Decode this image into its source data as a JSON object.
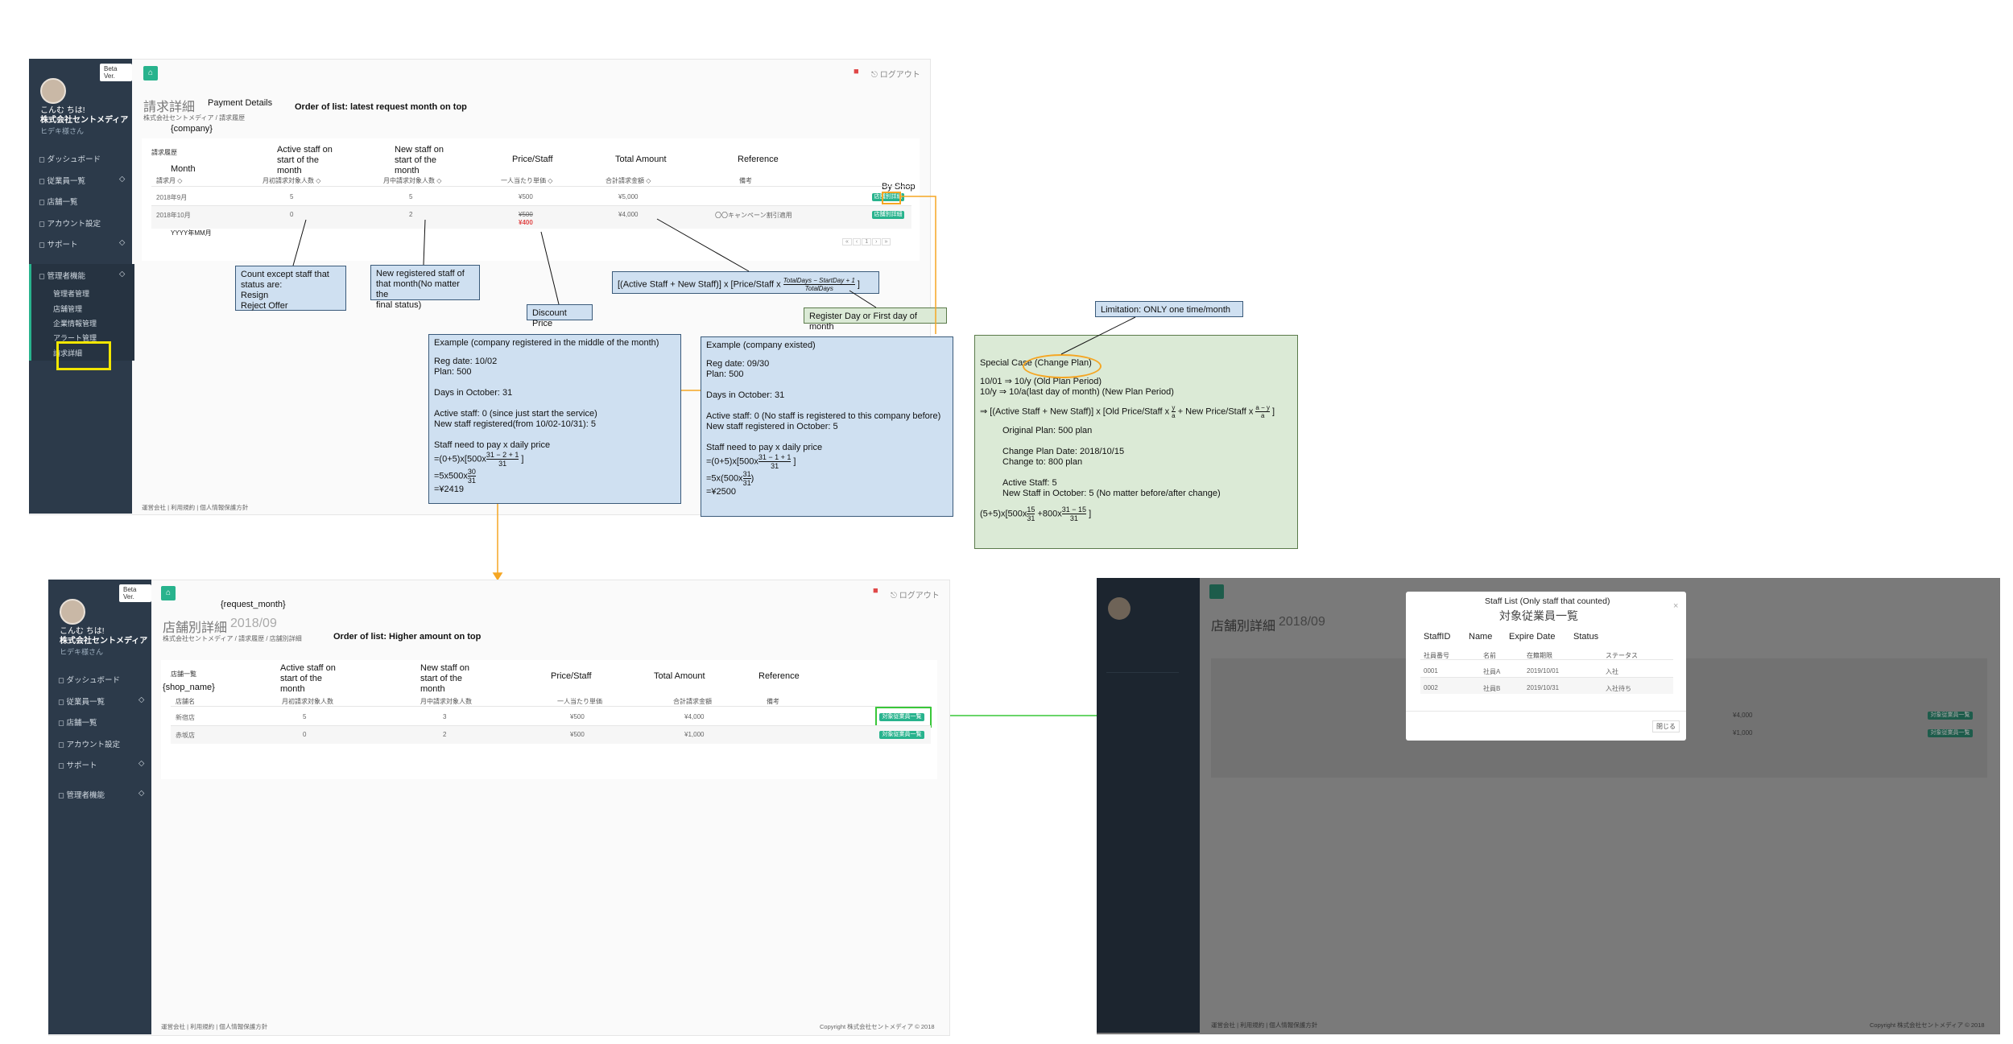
{
  "colors": {
    "sidebar": "#2c3a4a",
    "accent": "#28b38d",
    "annotation_blue": "#cfe0f1",
    "annotation_green": "#dbead6",
    "orange": "#f5a623",
    "highlight_yellow": "#f2e600",
    "arrow_green": "#39c739"
  },
  "screen1": {
    "beta": "Beta Ver.",
    "profile_name": "こんむ ちは!",
    "company": "株式会社セントメディア",
    "user": "ヒデキ様さん",
    "nav": [
      {
        "label": "ダッシュボード",
        "icon": "dashboard-icon"
      },
      {
        "label": "従業員一覧",
        "icon": "users-icon"
      },
      {
        "label": "店舗一覧",
        "icon": "store-icon"
      },
      {
        "label": "アカウント設定",
        "icon": "account-icon"
      },
      {
        "label": "サポート",
        "icon": "support-icon"
      },
      {
        "label": "管理者機能",
        "icon": "admin-icon"
      }
    ],
    "admin_sub": [
      "管理者管理",
      "店舗管理",
      "企業情報管理",
      "アラート管理",
      "請求詳細"
    ],
    "logout": "ログアウト",
    "title_jp": "請求詳細",
    "title_en": "Payment Details",
    "order_note": "Order of list: latest request month on top",
    "breadcrumb": "株式会社セントメディア  /  請求履歴",
    "company_var": "{company}",
    "card_title": "請求履歴",
    "col_en": [
      "Month",
      "Active staff on start of the month",
      "New staff on start of the month",
      "Price/Staff",
      "Total Amount",
      "Reference"
    ],
    "col_jp": [
      "請求月 ◇",
      "月初請求対象人数 ◇",
      "月中請求対象人数 ◇",
      "一人当たり単価 ◇",
      "合計請求金額 ◇",
      "備考"
    ],
    "by_shop": "By Shop",
    "rows": [
      {
        "month": "2018年9月",
        "active": "5",
        "new": "5",
        "price": "¥500",
        "total": "¥5,000",
        "ref": "",
        "btn": "店舗別詳細"
      },
      {
        "month": "2018年10月",
        "active": "0",
        "new": "2",
        "price_old": "¥500",
        "price": "¥400",
        "total": "¥4,000",
        "ref": "〇〇キャンペーン割引適用",
        "btn": "店舗別詳細"
      }
    ],
    "format_note": "YYYY年MM月",
    "pager": [
      "«",
      "‹",
      "1",
      "›",
      "»"
    ],
    "footer": "運営会社  |  利用規約  |  個人情報保護方針"
  },
  "annotations": {
    "count_except": "Count except staff that\nstatus are:\nResign\nReject Offer",
    "new_registered": "New registered staff of\nthat month(No matter the\nfinal status)",
    "discount": "Discount Price",
    "formula": "[(Active Staff + New Staff)] x [Price/Staff x ",
    "formula_frac_num": "TotalDays − StartDay + 1",
    "formula_frac_den": "TotalDays",
    "register_day": "Register Day or First day of month",
    "limitation": "Limitation: ONLY one time/month",
    "example1": {
      "title": "Example (company registered in the middle of the month)",
      "lines": [
        "Reg date: 10/02",
        "Plan: 500",
        "",
        "Days in October: 31",
        "",
        "Active staff: 0 (since just start the service)",
        "New staff registered(from 10/02-10/31): 5",
        "",
        "Staff need to pay x daily price"
      ],
      "calc1": "=(0+5)x[500x",
      "calc1_num": "31 − 2 + 1",
      "calc1_den": "31",
      "calc2": "=5x500x",
      "calc2_num": "30",
      "calc2_den": "31",
      "result": "=¥2419"
    },
    "example2": {
      "title": "Example (company existed)",
      "lines": [
        "Reg date: 09/30",
        "Plan: 500",
        "",
        "Days in October: 31",
        "",
        "Active staff: 0 (No staff is registered to this company before)",
        "New staff registered in October: 5",
        "",
        "Staff need to pay x daily price"
      ],
      "calc1": "=(0+5)x[500x",
      "calc1_num": "31 − 1 + 1",
      "calc1_den": "31",
      "calc2": "=5x(500x",
      "calc2_num": "31",
      "calc2_den": "31",
      "result": "=¥2500"
    },
    "special": {
      "title": "Special Case (Change Plan)",
      "line1": "10/01 ⇒ 10/y (Old Plan Period)",
      "line2": "10/y ⇒ 10/a(last day of month) (New Plan Period)",
      "formula": "⇒ [(Active Staff + New Staff)] x [Old Price/Staff x",
      "f_num1": "y",
      "f_den1": "a",
      "formula_mid": "+ New Price/Staff x",
      "f_num2": "a − y",
      "f_den2": "a",
      "details": [
        "Original Plan: 500 plan",
        "",
        "Change Plan Date: 2018/10/15",
        "Change to: 800 plan",
        "",
        "Active Staff: 5",
        "New Staff in October: 5 (No matter before/after change)"
      ],
      "calc": "(5+5)x[500x",
      "c_num1": "15",
      "c_den1": "31",
      "calc_mid": "+800x",
      "c_num2": "31 − 15",
      "c_den2": "31"
    }
  },
  "screen2": {
    "beta": "Beta Ver.",
    "profile_name": "こんむ ちは!",
    "company": "株式会社セントメディア",
    "user": "ヒデキ様さん",
    "nav": [
      {
        "label": "ダッシュボード",
        "icon": "dashboard-icon"
      },
      {
        "label": "従業員一覧",
        "icon": "users-icon"
      },
      {
        "label": "店舗一覧",
        "icon": "store-icon"
      },
      {
        "label": "アカウント設定",
        "icon": "account-icon"
      },
      {
        "label": "サポート",
        "icon": "support-icon"
      },
      {
        "label": "管理者機能",
        "icon": "admin-icon"
      }
    ],
    "logout": "ログアウト",
    "request_month_var": "{request_month}",
    "title_jp": "店舗別詳細",
    "title_month": "2018/09",
    "breadcrumb": "株式会社セントメディア  /  請求履歴  /  店舗別詳細",
    "order_note": "Order of list: Higher amount on top",
    "card_title": "店舗一覧",
    "shop_var": "{shop_name}",
    "col_en": [
      "Active staff on start of the month",
      "New staff on start of the month",
      "Price/Staff",
      "Total Amount",
      "Reference"
    ],
    "col_jp": [
      "店舗名",
      "月初請求対象人数",
      "月中請求対象人数",
      "一人当たり単価",
      "合計請求金額",
      "備考"
    ],
    "rows": [
      {
        "shop": "新宿店",
        "active": "5",
        "new": "3",
        "price": "¥500",
        "total": "¥4,000",
        "btn": "対象従業員一覧"
      },
      {
        "shop": "赤坂店",
        "active": "0",
        "new": "2",
        "price": "¥500",
        "total": "¥1,000",
        "btn": "対象従業員一覧"
      }
    ],
    "footer": "運営会社  |  利用規約  |  個人情報保護方針",
    "copyright": "Copyright 株式会社セントメディア © 2018"
  },
  "screen3": {
    "modal_note": "Staff List (Only staff that counted)",
    "modal_title": "対象従業員一覧",
    "col_en": [
      "StaffID",
      "Name",
      "Expire Date",
      "Status"
    ],
    "col_jp": [
      "社員番号",
      "名前",
      "在籍期限",
      "ステータス"
    ],
    "rows": [
      {
        "id": "0001",
        "name": "社員A",
        "date": "2019/10/01",
        "status": "入社"
      },
      {
        "id": "0002",
        "name": "社員B",
        "date": "2019/10/31",
        "status": "入社待ち"
      }
    ],
    "close": "閉じる",
    "close_x": "×",
    "bg_title": "店舗別詳細",
    "bg_month": "2018/09",
    "bg_rows_total": [
      "¥4,000",
      "¥1,000"
    ],
    "bg_btn": "対象従業員一覧",
    "copyright": "Copyright 株式会社セントメディア © 2018",
    "footer": "運営会社  |  利用規約  |  個人情報保護方針"
  }
}
